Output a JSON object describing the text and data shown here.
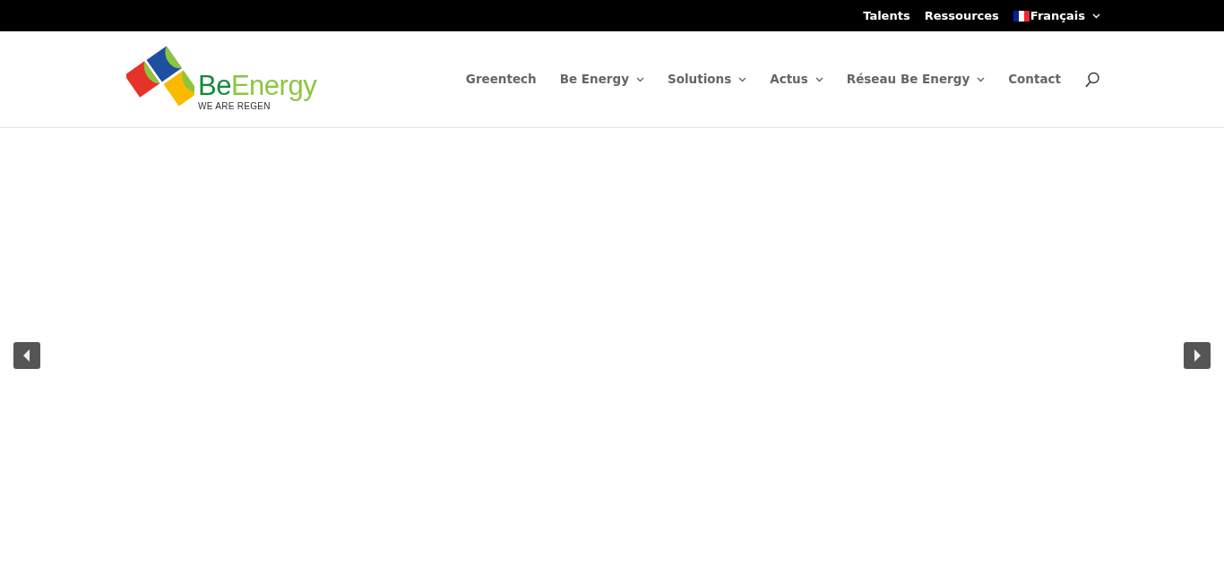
{
  "top_bar": {
    "links": [
      {
        "label": "Talents",
        "kind": "link"
      },
      {
        "label": "Ressources",
        "kind": "link"
      },
      {
        "label": "Français",
        "kind": "language"
      }
    ]
  },
  "logo": {
    "wordmark": [
      "Be",
      "Energy"
    ],
    "tagline": "WE ARE REGEN"
  },
  "nav": [
    {
      "label": "Greentech",
      "has_dropdown": false
    },
    {
      "label": "Be Energy",
      "has_dropdown": true
    },
    {
      "label": "Solutions",
      "has_dropdown": true
    },
    {
      "label": "Actus",
      "has_dropdown": true
    },
    {
      "label": "Réseau Be Energy",
      "has_dropdown": true
    },
    {
      "label": "Contact",
      "has_dropdown": false
    }
  ]
}
